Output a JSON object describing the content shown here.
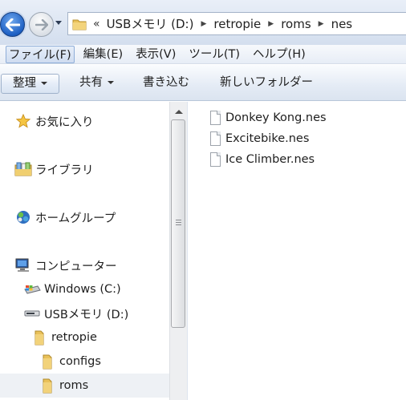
{
  "address_bar": {
    "overflow": "«",
    "crumbs": [
      "USBメモリ (D:)",
      "retropie",
      "roms",
      "nes"
    ]
  },
  "menu": [
    "ファイル(F)",
    "編集(E)",
    "表示(V)",
    "ツール(T)",
    "ヘルプ(H)"
  ],
  "commands": {
    "organize": "整理",
    "share": "共有",
    "burn": "書き込む",
    "new_folder": "新しいフォルダー"
  },
  "nav": {
    "favorites": "お気に入り",
    "libraries": "ライブラリ",
    "homegroup": "ホームグループ",
    "computer": "コンピューター",
    "drive_c": "Windows (C:)",
    "drive_d": "USBメモリ (D:)",
    "retropie": "retropie",
    "configs": "configs",
    "roms": "roms"
  },
  "files": [
    "Donkey Kong.nes",
    "Excitebike.nes",
    "Ice Climber.nes"
  ],
  "colors": {
    "accent": "#1d5fc3",
    "folder": "#e9c15a",
    "selection": "#eef1f5"
  }
}
